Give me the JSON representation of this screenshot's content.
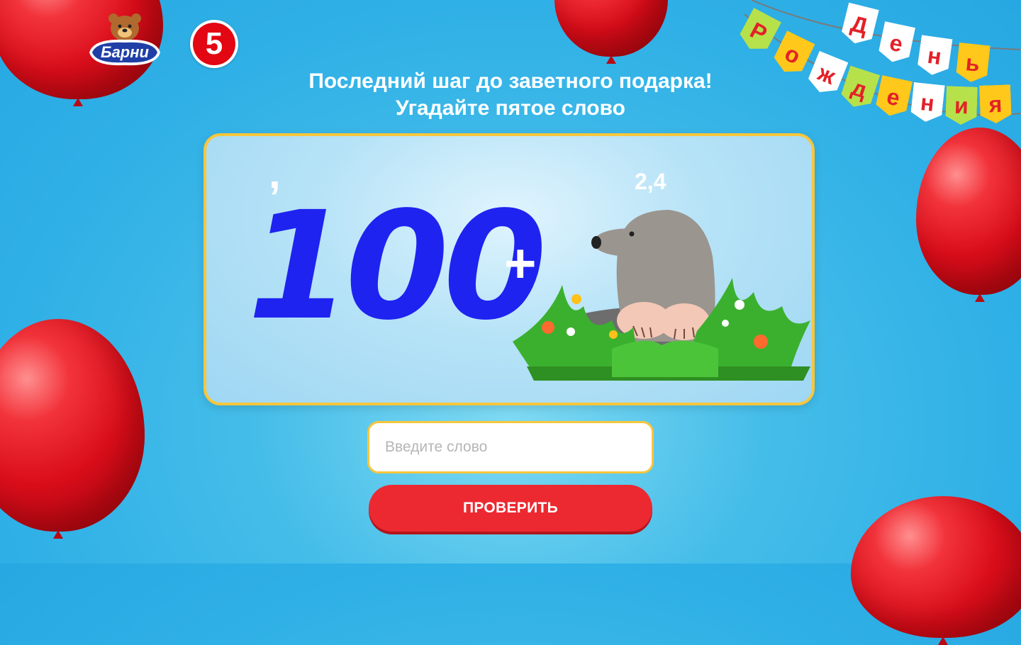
{
  "brand": {
    "barni_logo_text": "Барни",
    "pyaterochka_logo_text": "5"
  },
  "heading": {
    "line1": "Последний шаг до заветного подарка!",
    "line2": "Угадайте пятое слово"
  },
  "puzzle": {
    "comma": ",",
    "number": "100",
    "plus": "+",
    "letter_positions": "2,4",
    "image_icon": "mole-in-grass-icon"
  },
  "form": {
    "input_placeholder": "Введите слово",
    "input_value": "",
    "submit_label": "ПРОВЕРИТЬ"
  },
  "garland": {
    "word1_letters": [
      "Д",
      "е",
      "н",
      "ь"
    ],
    "word2_letters": [
      "Р",
      "о",
      "ж",
      "д",
      "е",
      "н",
      "и",
      "я"
    ]
  },
  "colors": {
    "background": "#2fb0e6",
    "accent_yellow": "#f8c63c",
    "button_red": "#ec2931",
    "number_blue": "#1e23f0"
  }
}
